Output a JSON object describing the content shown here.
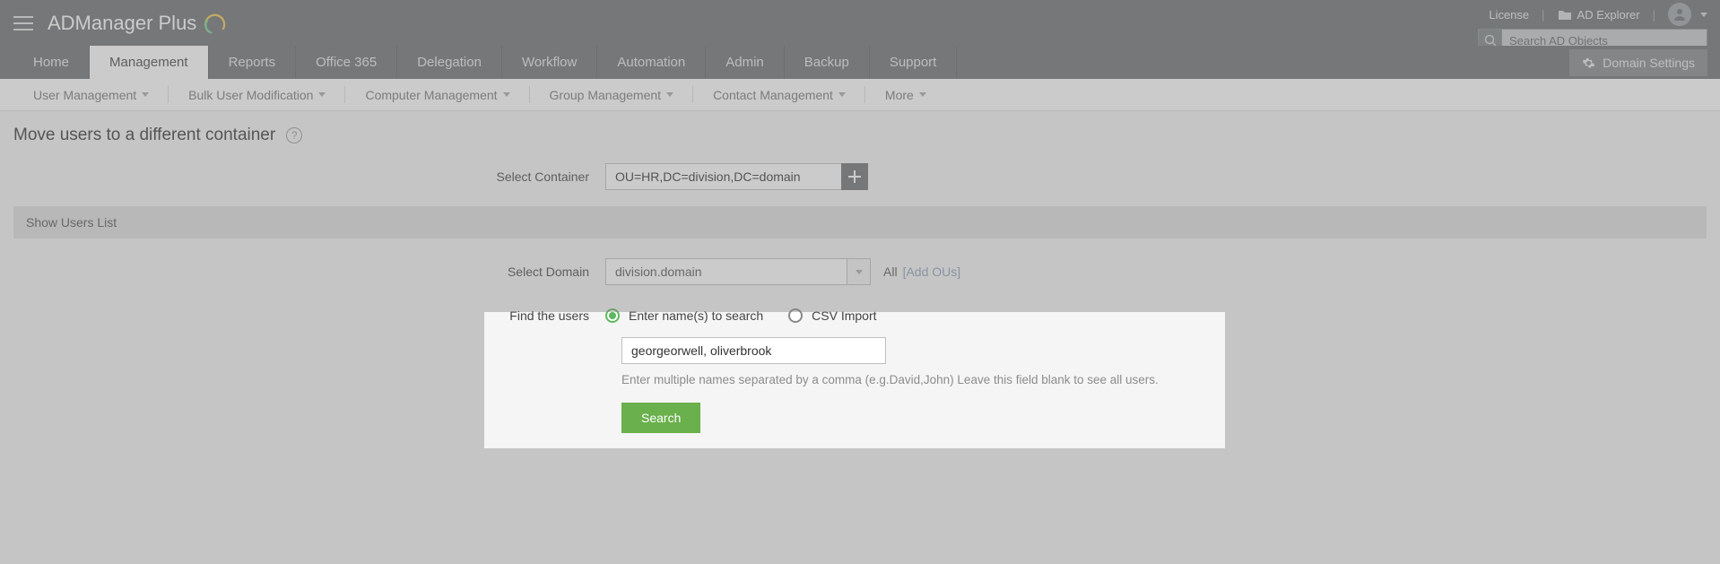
{
  "brand": {
    "name": "ADManager Plus"
  },
  "top_links": {
    "license": "License",
    "ad_explorer": "AD Explorer"
  },
  "search": {
    "placeholder": "Search AD Objects"
  },
  "domain_settings_label": "Domain Settings",
  "main_tabs": {
    "home": "Home",
    "management": "Management",
    "reports": "Reports",
    "office365": "Office 365",
    "delegation": "Delegation",
    "workflow": "Workflow",
    "automation": "Automation",
    "admin": "Admin",
    "backup": "Backup",
    "support": "Support"
  },
  "sub_tabs": {
    "user_mgmt": "User Management",
    "bulk_user": "Bulk User Modification",
    "computer_mgmt": "Computer Management",
    "group_mgmt": "Group Management",
    "contact_mgmt": "Contact Management",
    "more": "More"
  },
  "page": {
    "title": "Move users to a different container"
  },
  "form": {
    "select_container_label": "Select Container",
    "container_value": "OU=HR,DC=division,DC=domain",
    "section_heading": "Show Users List",
    "select_domain_label": "Select Domain",
    "domain_value": "division.domain",
    "all_label": "All",
    "add_ous": "[Add OUs]",
    "find_users_label": "Find the users",
    "radio": {
      "enter_names": "Enter name(s) to search",
      "csv_import": "CSV Import"
    },
    "names_value": "georgeorwell, oliverbrook",
    "helper_text": "Enter multiple names separated by a comma (e.g.David,John) Leave this field blank to see all users.",
    "search_button": "Search"
  }
}
